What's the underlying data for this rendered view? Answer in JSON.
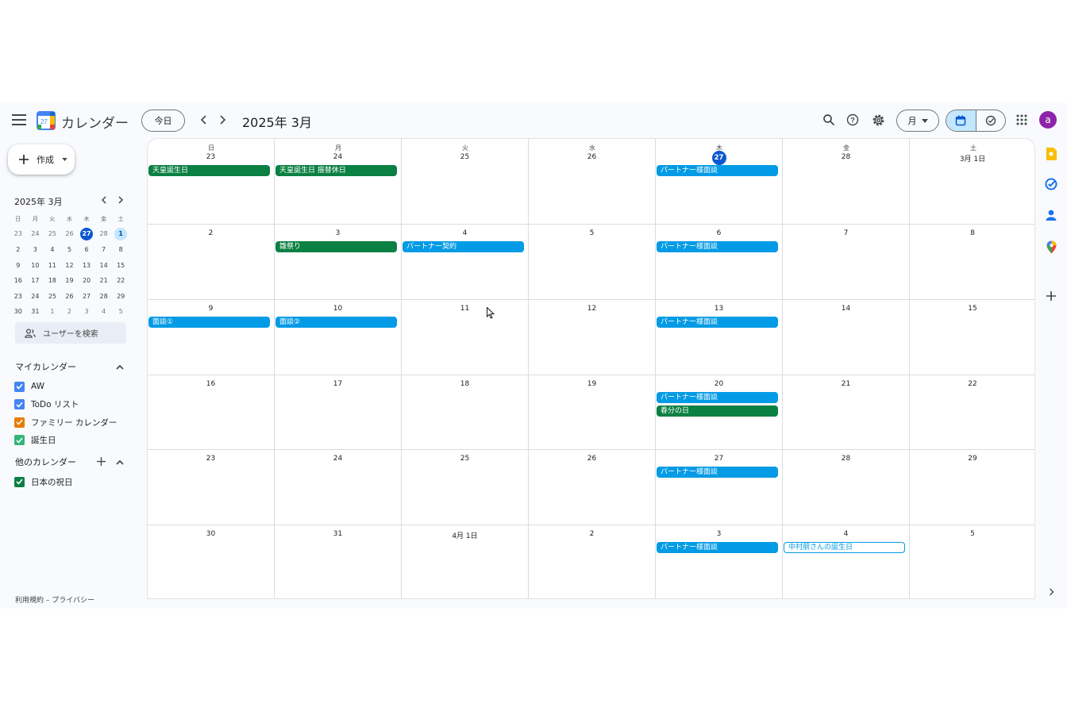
{
  "header": {
    "app_name": "カレンダー",
    "logo_day": "27",
    "today_label": "今日",
    "period_title": "2025年 3月",
    "view_label": "月",
    "avatar_letter": "a"
  },
  "sidebar": {
    "create_label": "作成",
    "mini_calendar": {
      "title": "2025年 3月",
      "weekdays": [
        "日",
        "月",
        "火",
        "水",
        "木",
        "金",
        "土"
      ],
      "weeks": [
        [
          "23",
          "24",
          "25",
          "26",
          "27",
          "28",
          "1"
        ],
        [
          "2",
          "3",
          "4",
          "5",
          "6",
          "7",
          "8"
        ],
        [
          "9",
          "10",
          "11",
          "12",
          "13",
          "14",
          "15"
        ],
        [
          "16",
          "17",
          "18",
          "19",
          "20",
          "21",
          "22"
        ],
        [
          "23",
          "24",
          "25",
          "26",
          "27",
          "28",
          "29"
        ],
        [
          "30",
          "31",
          "1",
          "2",
          "3",
          "4",
          "5"
        ]
      ],
      "today": "27",
      "selected": "1"
    },
    "search_users_label": "ユーザーを検索",
    "my_calendars_label": "マイカレンダー",
    "my_calendars": [
      {
        "label": "AW",
        "color": "#4285f4"
      },
      {
        "label": "ToDo リスト",
        "color": "#4285f4"
      },
      {
        "label": "ファミリー カレンダー",
        "color": "#e67c00"
      },
      {
        "label": "誕生日",
        "color": "#33b679"
      }
    ],
    "other_calendars_label": "他のカレンダー",
    "other_calendars": [
      {
        "label": "日本の祝日",
        "color": "#0b8043"
      }
    ],
    "footer": "利用規約 – プライバシー"
  },
  "grid": {
    "weekdays": [
      "日",
      "月",
      "火",
      "水",
      "木",
      "金",
      "土"
    ],
    "weeks": [
      [
        {
          "date": "23",
          "events": [
            {
              "title": "天皇誕生日",
              "style": "green"
            }
          ]
        },
        {
          "date": "24",
          "events": [
            {
              "title": "天皇誕生日 振替休日",
              "style": "green"
            }
          ]
        },
        {
          "date": "25",
          "events": []
        },
        {
          "date": "26",
          "events": []
        },
        {
          "date": "27",
          "today": true,
          "events": [
            {
              "title": "パートナー様面談",
              "style": "blue"
            }
          ]
        },
        {
          "date": "28",
          "events": []
        },
        {
          "date": "3月 1日",
          "events": []
        }
      ],
      [
        {
          "date": "2",
          "events": []
        },
        {
          "date": "3",
          "events": [
            {
              "title": "雛祭り",
              "style": "green"
            }
          ]
        },
        {
          "date": "4",
          "events": [
            {
              "title": "パートナー契約",
              "style": "blue"
            }
          ]
        },
        {
          "date": "5",
          "events": []
        },
        {
          "date": "6",
          "events": [
            {
              "title": "パートナー様面談",
              "style": "blue"
            }
          ]
        },
        {
          "date": "7",
          "events": []
        },
        {
          "date": "8",
          "events": []
        }
      ],
      [
        {
          "date": "9",
          "events": [
            {
              "title": "面談①",
              "style": "blue"
            }
          ]
        },
        {
          "date": "10",
          "events": [
            {
              "title": "面談②",
              "style": "blue"
            }
          ]
        },
        {
          "date": "11",
          "events": []
        },
        {
          "date": "12",
          "events": []
        },
        {
          "date": "13",
          "events": [
            {
              "title": "パートナー様面談",
              "style": "blue"
            }
          ]
        },
        {
          "date": "14",
          "events": []
        },
        {
          "date": "15",
          "events": []
        }
      ],
      [
        {
          "date": "16",
          "events": []
        },
        {
          "date": "17",
          "events": []
        },
        {
          "date": "18",
          "events": []
        },
        {
          "date": "19",
          "events": []
        },
        {
          "date": "20",
          "events": [
            {
              "title": "パートナー様面談",
              "style": "blue"
            },
            {
              "title": "春分の日",
              "style": "green"
            }
          ]
        },
        {
          "date": "21",
          "events": []
        },
        {
          "date": "22",
          "events": []
        }
      ],
      [
        {
          "date": "23",
          "events": []
        },
        {
          "date": "24",
          "events": []
        },
        {
          "date": "25",
          "events": []
        },
        {
          "date": "26",
          "events": []
        },
        {
          "date": "27",
          "events": [
            {
              "title": "パートナー様面談",
              "style": "blue"
            }
          ]
        },
        {
          "date": "28",
          "events": []
        },
        {
          "date": "29",
          "events": []
        }
      ],
      [
        {
          "date": "30",
          "events": []
        },
        {
          "date": "31",
          "events": []
        },
        {
          "date": "4月 1日",
          "events": []
        },
        {
          "date": "2",
          "events": []
        },
        {
          "date": "3",
          "events": [
            {
              "title": "パートナー様面談",
              "style": "blue"
            }
          ]
        },
        {
          "date": "4",
          "events": [
            {
              "title": "中村朋さんの誕生日",
              "style": "outline"
            }
          ]
        },
        {
          "date": "5",
          "events": []
        }
      ]
    ]
  },
  "side_panel": {
    "icons": [
      "keep-icon",
      "tasks-icon",
      "contacts-icon",
      "maps-icon"
    ]
  },
  "colors": {
    "accent": "#0b57d0",
    "event_blue": "#039be5",
    "event_green": "#0b8043",
    "selected_bg": "#c2e7ff"
  }
}
